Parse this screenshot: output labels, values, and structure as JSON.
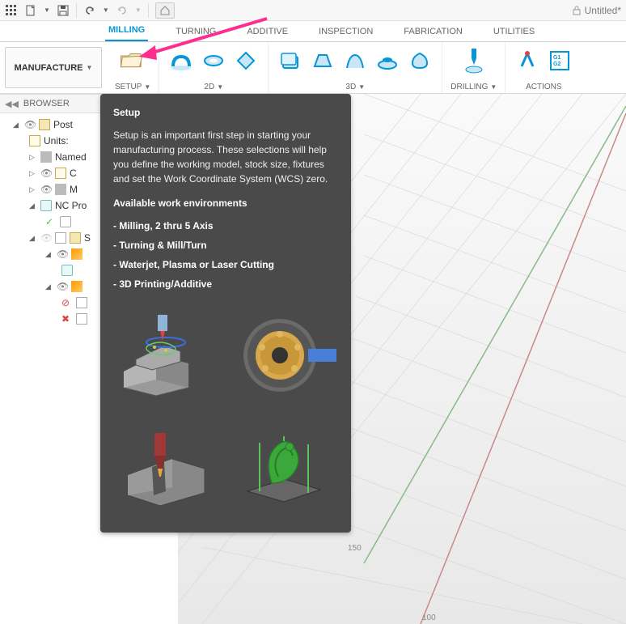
{
  "title": "Untitled*",
  "workspace": "MANUFACTURE",
  "tabs": {
    "milling": "MILLING",
    "turning": "TURNING",
    "additive": "ADDITIVE",
    "inspection": "INSPECTION",
    "fabrication": "FABRICATION",
    "utilities": "UTILITIES"
  },
  "ribbon": {
    "setup": "SETUP",
    "2d": "2D",
    "3d": "3D",
    "drilling": "DRILLING",
    "actions": "ACTIONS"
  },
  "browser": {
    "header": "BROWSER",
    "items": {
      "root": "Post",
      "units": "Units:",
      "named": "Named",
      "c": "C",
      "m": "M",
      "nc": "NC Pro",
      "s": "S"
    }
  },
  "canvas": {
    "tick150": "150",
    "tick100": "100"
  },
  "tooltip": {
    "title": "Setup",
    "body": "Setup is an important first step in starting your manufacturing process. These selections will help you define the working model, stock size, fixtures and set the Work Coordinate System (WCS) zero.",
    "avail": "Available work environments",
    "l1": "- Milling, 2 thru 5 Axis",
    "l2": "- Turning & Mill/Turn",
    "l3": "- Waterjet, Plasma or Laser Cutting",
    "l4": "- 3D Printing/Additive"
  }
}
